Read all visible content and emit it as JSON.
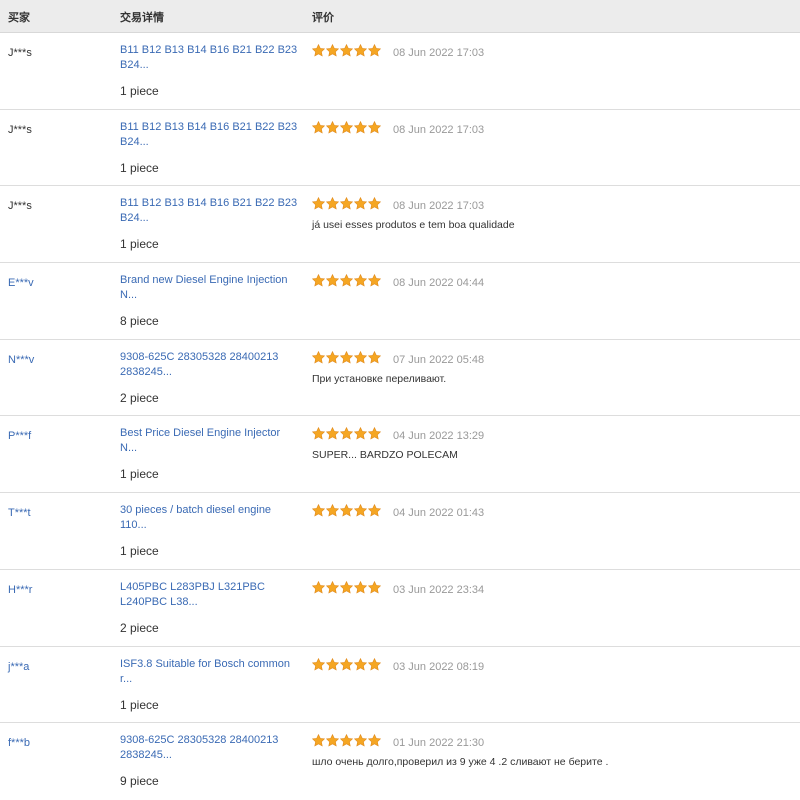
{
  "header": {
    "buyer": "买家",
    "detail": "交易详情",
    "review": "评价"
  },
  "colors": {
    "link": "#3a6ab4",
    "star": "#f5a623",
    "header_bg": "#ececec"
  },
  "rows": [
    {
      "buyer": "J***s",
      "buyer_is_link": false,
      "product": "B11 B12 B13 B14 B16 B21 B22 B23\nB24...",
      "quantity": "1 piece",
      "rating": 5,
      "date": "08 Jun 2022 17:03",
      "comment": ""
    },
    {
      "buyer": "J***s",
      "buyer_is_link": false,
      "product": "B11 B12 B13 B14 B16 B21 B22 B23\nB24...",
      "quantity": "1 piece",
      "rating": 5,
      "date": "08 Jun 2022 17:03",
      "comment": ""
    },
    {
      "buyer": "J***s",
      "buyer_is_link": false,
      "product": "B11 B12 B13 B14 B16 B21 B22 B23\nB24...",
      "quantity": "1 piece",
      "rating": 5,
      "date": "08 Jun 2022 17:03",
      "comment": "já usei esses produtos e tem boa qualidade"
    },
    {
      "buyer": "E***v",
      "buyer_is_link": true,
      "product": "Brand new Diesel Engine Injection N...",
      "quantity": "8 piece",
      "rating": 5,
      "date": "08 Jun 2022 04:44",
      "comment": ""
    },
    {
      "buyer": "N***v",
      "buyer_is_link": true,
      "product": "9308-625C 28305328 28400213\n2838245...",
      "quantity": "2 piece",
      "rating": 5,
      "date": "07 Jun 2022 05:48",
      "comment": "При установке переливают."
    },
    {
      "buyer": "P***f",
      "buyer_is_link": true,
      "product": "Best Price Diesel Engine Injector N...",
      "quantity": "1 piece",
      "rating": 5,
      "date": "04 Jun 2022 13:29",
      "comment": "SUPER... BARDZO POLECAM"
    },
    {
      "buyer": "T***t",
      "buyer_is_link": true,
      "product": "30 pieces / batch diesel engine 110...",
      "quantity": "1 piece",
      "rating": 5,
      "date": "04 Jun 2022 01:43",
      "comment": ""
    },
    {
      "buyer": "H***r",
      "buyer_is_link": true,
      "product": "L405PBC L283PBJ L321PBC\nL240PBC L38...",
      "quantity": "2 piece",
      "rating": 5,
      "date": "03 Jun 2022 23:34",
      "comment": ""
    },
    {
      "buyer": "j***a",
      "buyer_is_link": true,
      "product": "ISF3.8 Suitable for Bosch common r...",
      "quantity": "1 piece",
      "rating": 5,
      "date": "03 Jun 2022 08:19",
      "comment": ""
    },
    {
      "buyer": "f***b",
      "buyer_is_link": true,
      "product": "9308-625C 28305328 28400213\n2838245...",
      "quantity": "9 piece",
      "rating": 5,
      "date": "01 Jun 2022 21:30",
      "comment": "шло очень долго,проверил из 9 уже 4 .2 сливают не берите ."
    }
  ]
}
